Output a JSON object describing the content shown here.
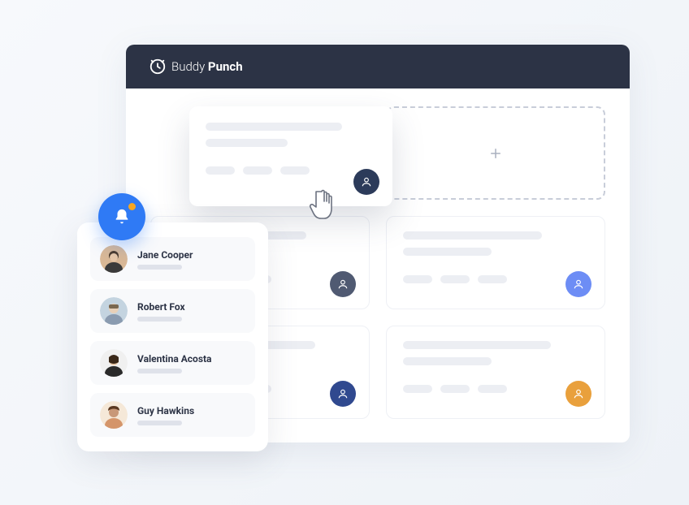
{
  "brand": {
    "name_light": "Buddy",
    "name_bold": "Punch"
  },
  "colors": {
    "header": "#2c3345",
    "primary_blue": "#2f7af5",
    "dot_navy": "#2c3b5a",
    "dot_slate": "#505a72",
    "dot_blue": "#6d8df5",
    "dot_blue2": "#30498f",
    "dot_amber": "#e9a03c",
    "alert": "#f5a623"
  },
  "notifications": {
    "items": [
      {
        "name": "Jane Cooper"
      },
      {
        "name": "Robert Fox"
      },
      {
        "name": "Valentina Acosta"
      },
      {
        "name": "Guy Hawkins"
      }
    ]
  },
  "cards": [
    {
      "slot": "top-left",
      "elevated": true,
      "dot": "navy"
    },
    {
      "slot": "top-right",
      "type": "add"
    },
    {
      "slot": "mid-left",
      "dot": "slate"
    },
    {
      "slot": "mid-right",
      "dot": "blue"
    },
    {
      "slot": "bot-left",
      "dot": "blue2"
    },
    {
      "slot": "bot-right",
      "dot": "amber"
    }
  ]
}
